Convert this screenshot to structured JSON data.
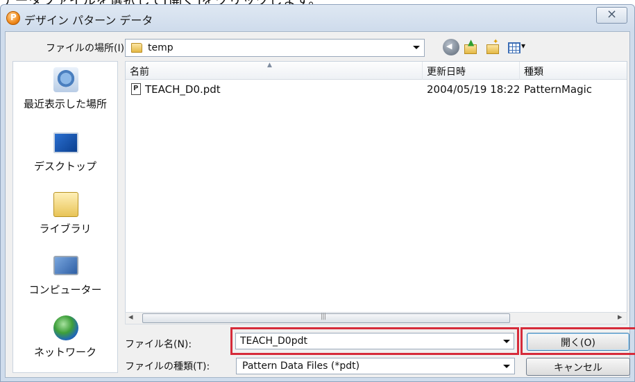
{
  "window": {
    "title": "デザイン パターン データ",
    "close_label": "",
    "tutorial_caption": "データファイルを選択して[開く]をクリックします。"
  },
  "lookin": {
    "label": "ファイルの場所(I):",
    "value": "temp"
  },
  "toolbar": {
    "icons": [
      "back-icon",
      "up-folder-icon",
      "new-folder-icon",
      "view-menu-icon"
    ]
  },
  "places": [
    {
      "label": "最近表示した場所",
      "icon": "recent-places-icon"
    },
    {
      "label": "デスクトップ",
      "icon": "desktop-icon"
    },
    {
      "label": "ライブラリ",
      "icon": "library-icon"
    },
    {
      "label": "コンピューター",
      "icon": "computer-icon"
    },
    {
      "label": "ネットワーク",
      "icon": "network-icon"
    }
  ],
  "filelist": {
    "columns": [
      "名前",
      "更新日時",
      "種類"
    ],
    "rows": [
      {
        "name": "TEACH_D0.pdt",
        "date": "2004/05/19 18:22",
        "type": "PatternMagic"
      }
    ]
  },
  "filename": {
    "label": "ファイル名(N):",
    "value": "TEACH_D0pdt"
  },
  "filetype": {
    "label": "ファイルの種類(T):",
    "value": "Pattern Data Files (*pdt)"
  },
  "buttons": {
    "open": "開く(O)",
    "cancel": "キャンセル"
  },
  "colors": {
    "highlight": "#d62b3a",
    "titlebar": "#cfdcec"
  }
}
